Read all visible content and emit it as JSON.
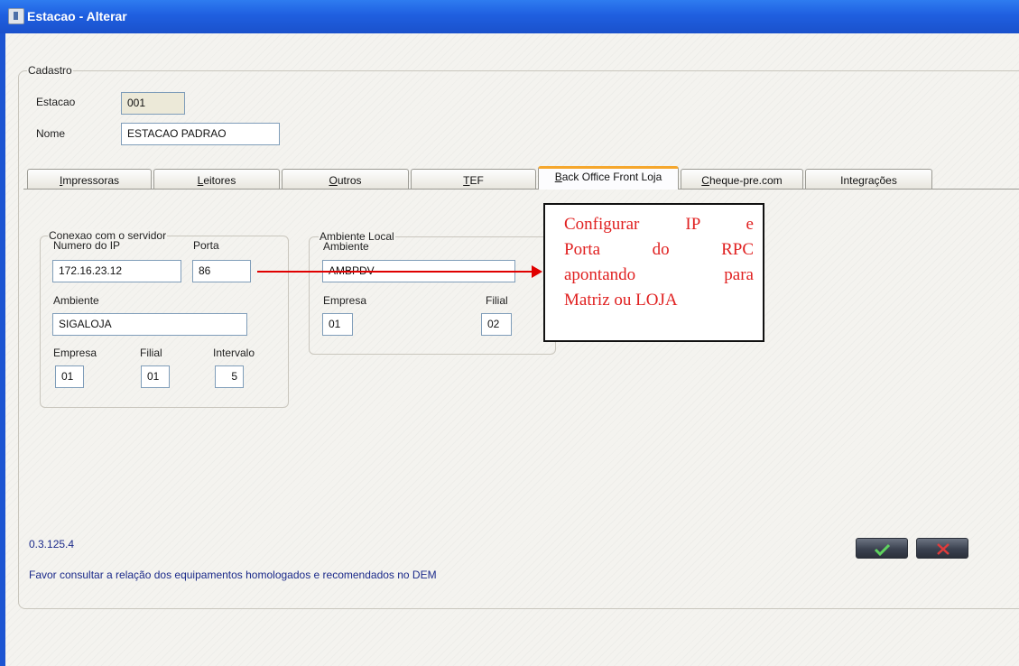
{
  "window": {
    "title": "Estacao - Alterar"
  },
  "cadastro": {
    "legend": "Cadastro",
    "estacao_label": "Estacao",
    "estacao_value": "001",
    "nome_label": "Nome",
    "nome_value": "ESTACAO PADRAO"
  },
  "tabs": [
    {
      "pre": "",
      "u": "I",
      "post": "mpressoras"
    },
    {
      "pre": "",
      "u": "L",
      "post": "eitores"
    },
    {
      "pre": "",
      "u": "O",
      "post": "utros"
    },
    {
      "pre": "",
      "u": "T",
      "post": "EF"
    },
    {
      "pre": "",
      "u": "B",
      "post": "ack Office Front Loja"
    },
    {
      "pre": "",
      "u": "C",
      "post": "heque-pre.com"
    },
    {
      "pre": "Inte",
      "u": "g",
      "post": "rações"
    }
  ],
  "active_tab": "Back Office Front Loja",
  "servidor": {
    "legend": "Conexao com o servidor",
    "ip_label": "Numero do IP",
    "ip_value": "172.16.23.12",
    "porta_label": "Porta",
    "porta_value": "86",
    "ambiente_label": "Ambiente",
    "ambiente_value": "SIGALOJA",
    "empresa_label": "Empresa",
    "empresa_value": "01",
    "filial_label": "Filial",
    "filial_value": "01",
    "intervalo_label": "Intervalo",
    "intervalo_value": "5"
  },
  "local": {
    "legend": "Ambiente Local",
    "ambiente_label": "Ambiente",
    "ambiente_value": "AMBPDV",
    "empresa_label": "Empresa",
    "empresa_value": "01",
    "filial_label": "Filial",
    "filial_value": "02"
  },
  "annotation": {
    "lines": [
      "Configurar IP e",
      "Porta do RPC",
      "apontando para",
      "Matriz ou LOJA"
    ],
    "color": "#e02020"
  },
  "footer": {
    "version": "0.3.125.4",
    "note": "Favor consultar a relação dos equipamentos homologados e recomendados no DEM"
  },
  "buttons": {
    "confirm_icon": "check-icon",
    "cancel_icon": "close-icon"
  }
}
